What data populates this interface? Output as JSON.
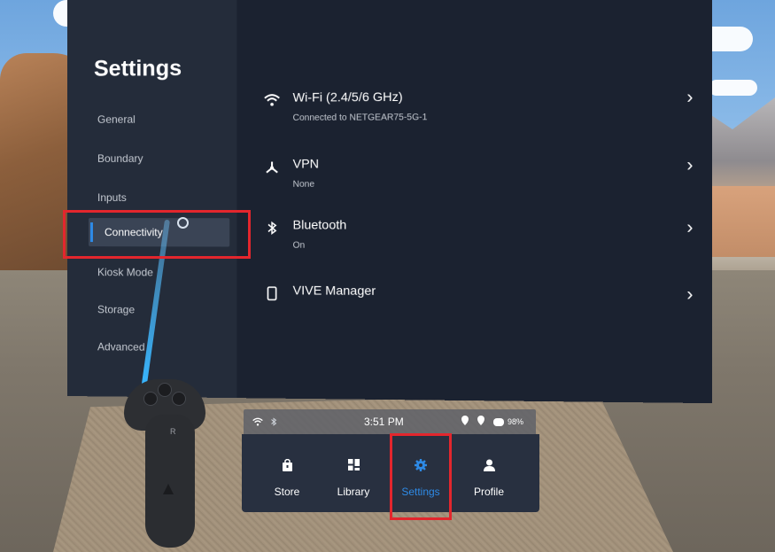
{
  "settings": {
    "title": "Settings",
    "sidebar_items": [
      "General",
      "Boundary",
      "Inputs",
      "Connectivity",
      "Kiosk Mode",
      "Storage",
      "Advanced"
    ],
    "active_item": "Connectivity",
    "rows": [
      {
        "icon": "wifi-icon",
        "title": "Wi-Fi (2.4/5/6 GHz)",
        "subtitle": "Connected to NETGEAR75-5G-1"
      },
      {
        "icon": "vpn-icon",
        "title": "VPN",
        "subtitle": "None"
      },
      {
        "icon": "bluetooth-icon",
        "title": "Bluetooth",
        "subtitle": "On"
      },
      {
        "icon": "phone-icon",
        "title": "VIVE Manager",
        "subtitle": ""
      }
    ]
  },
  "dock": {
    "time": "3:51 PM",
    "battery": "98%",
    "items": [
      {
        "icon": "store-icon",
        "label": "Store"
      },
      {
        "icon": "library-icon",
        "label": "Library"
      },
      {
        "icon": "gear-icon",
        "label": "Settings"
      },
      {
        "icon": "person-icon",
        "label": "Profile"
      }
    ],
    "active": "Settings"
  },
  "controller": {
    "label": "R"
  },
  "colors": {
    "accent": "#2e8ae6",
    "highlight": "#e3262d",
    "panel": "#1b2230"
  }
}
